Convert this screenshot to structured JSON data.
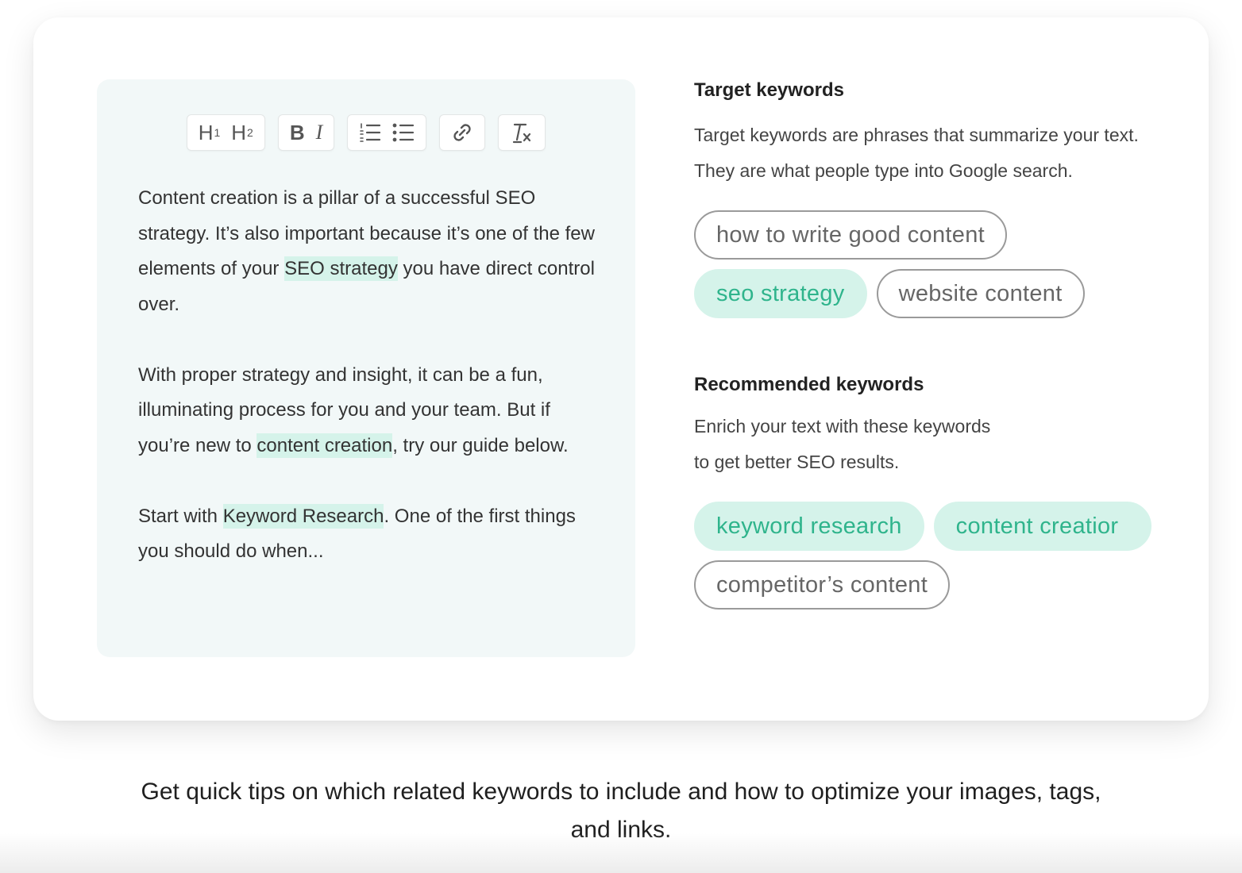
{
  "editor": {
    "toolbar": {
      "h1": "H",
      "h1_sub": "1",
      "h2": "H",
      "h2_sub": "2",
      "bold": "B",
      "italic": "I"
    },
    "paragraphs": [
      {
        "t1": "Content creation is a pillar of a successful SEO strategy. It’s also important because it’s one of the few elements of your ",
        "hl": "SEO strategy",
        "t2": " you have direct control over."
      },
      {
        "t1": "With proper strategy and insight, it can be a fun, illuminating process for you and your team. But if you’re new to ",
        "hl": "content creation",
        "t2": ", try our guide below."
      },
      {
        "t1": "Start with ",
        "hl": "Keyword Research",
        "t2": ". One of the first things you should do when..."
      }
    ]
  },
  "target": {
    "heading": "Target keywords",
    "description": "Target keywords are phrases that summarize your text. They are what people type into Google search.",
    "chips": [
      {
        "label": "how to write good content",
        "style": "outline"
      },
      {
        "label": "seo strategy",
        "style": "filled"
      },
      {
        "label": "website content",
        "style": "outline"
      }
    ]
  },
  "recommended": {
    "heading": "Recommended keywords",
    "description_line1": "Enrich your text with these keywords",
    "description_line2": "to get better SEO results.",
    "chips": [
      {
        "label": "keyword research",
        "style": "filled"
      },
      {
        "label": "content creatior",
        "style": "filled"
      },
      {
        "label": "competitor’s content",
        "style": "outline"
      }
    ]
  },
  "caption": "Get quick tips on which related keywords to include and how to optimize your images, tags, and links.",
  "colors": {
    "accent": "#2fb48c",
    "highlight": "#d5f3ea",
    "editor_bg": "#f2f8f8"
  }
}
